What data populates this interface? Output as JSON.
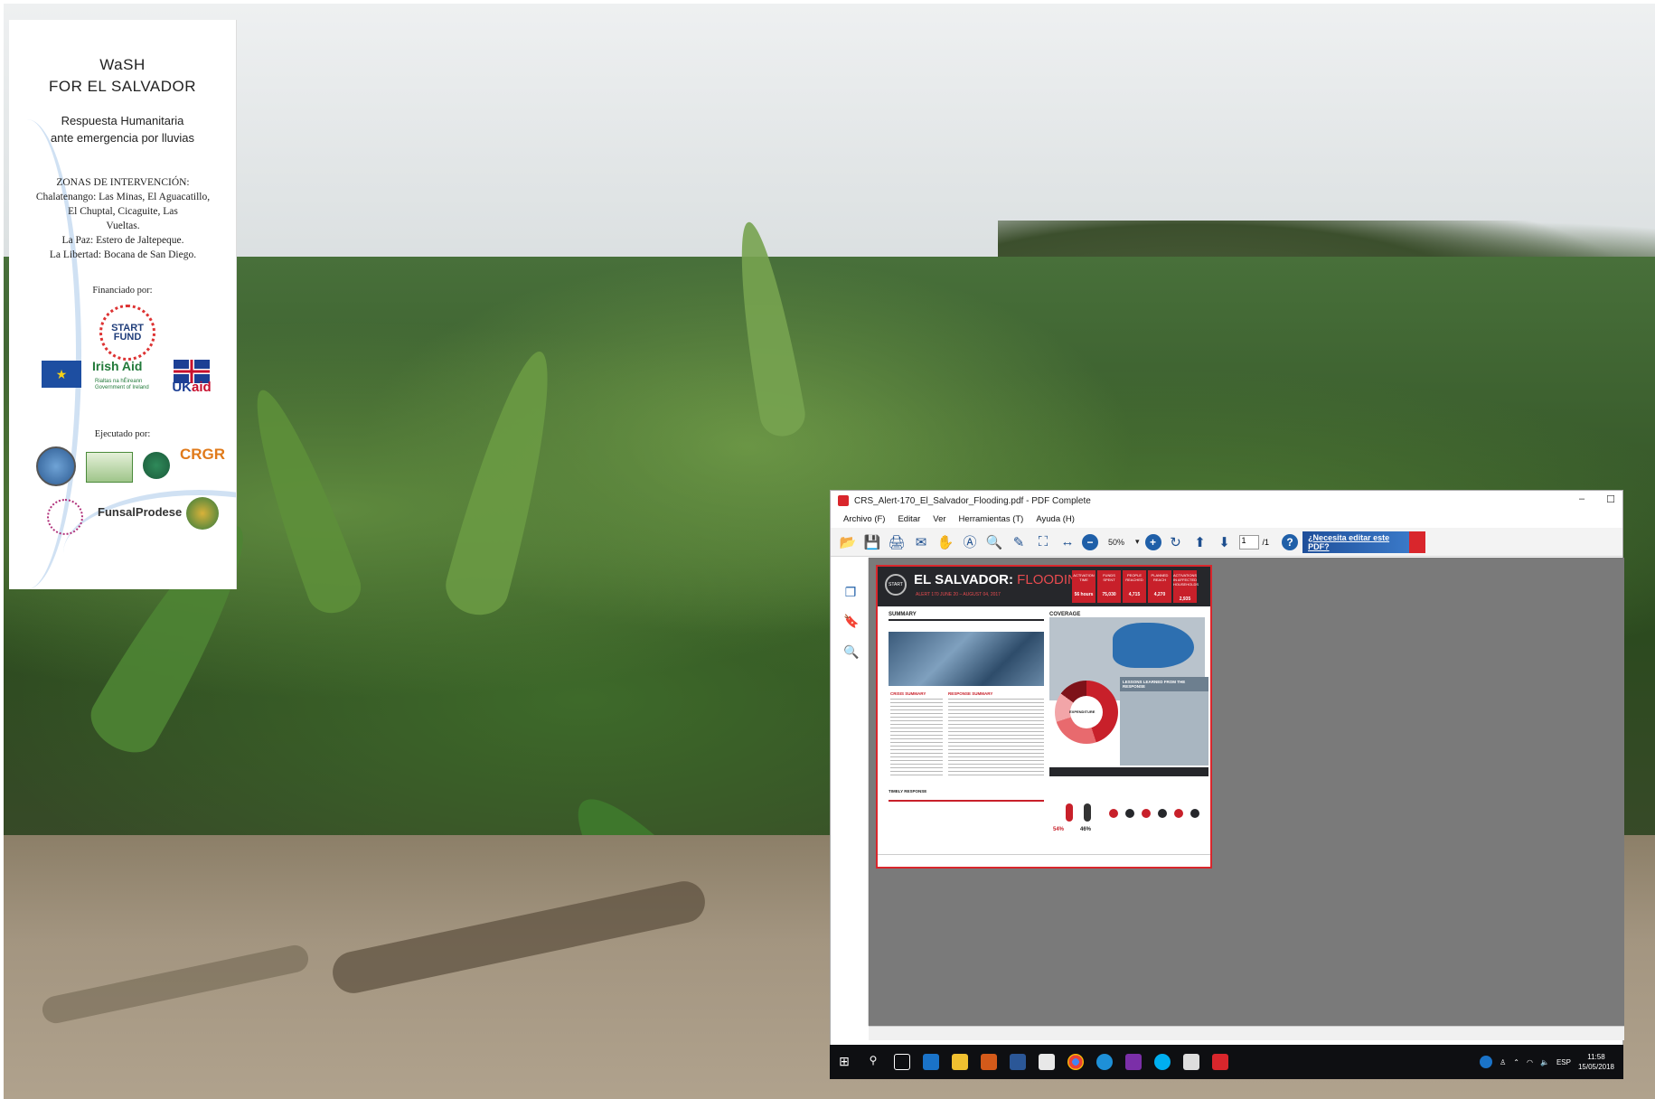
{
  "card": {
    "title_line1": "WaSH",
    "title_line2": "FOR EL SALVADOR",
    "subtitle_line1": "Respuesta Humanitaria",
    "subtitle_line2": "ante emergencia por lluvias",
    "zones_heading": "ZONAS DE INTERVENCIÓN:",
    "zones_line1": "Chalatenango: Las Minas, El Aguacatillo,",
    "zones_line2": "El Chuptal, Cicaguite, Las",
    "zones_line3": "Vueltas.",
    "zones_line4": "La Paz: Estero de Jaltepeque.",
    "zones_line5": "La Libertad: Bocana de San Diego.",
    "funded_by": "Financiado por:",
    "executed_by": "Ejecutado por:",
    "start_logo_l1": "START",
    "start_logo_l2": "FUND",
    "irish_aid": "Irish Aid",
    "irish_aid_sub1": "Rialtas na hÉireann",
    "irish_aid_sub2": "Government of Ireland",
    "uk": "UK",
    "aid": "aid",
    "crgr": "CRGR",
    "funsal": "FunsalProdese"
  },
  "window": {
    "title": "CRS_Alert-170_El_Salvador_Flooding.pdf - PDF Complete",
    "minimize": "–",
    "maximize": "☐",
    "menu": [
      "Archivo (F)",
      "Editar",
      "Ver",
      "Herramientas (T)",
      "Ayuda (H)"
    ],
    "zoom": "50%",
    "page_current": "1",
    "page_total": "/1",
    "ad_text": "¿Necesita editar este PDF?"
  },
  "pdf": {
    "title_a": "EL SALVADOR:",
    "title_b": " FLOODING",
    "date": "ALERT 170 JUNE 20 – AUGUST 04, 2017",
    "stats": [
      {
        "label": "ACTIVATION TIME",
        "value": "56 hours"
      },
      {
        "label": "FUNDS SPENT",
        "value": "75,030"
      },
      {
        "label": "PEOPLE REACHED",
        "value": "4,715"
      },
      {
        "label": "PLANNED REACH",
        "value": "4,270"
      },
      {
        "label": "ACTIVATIONS IN AFFECTED HOUSEHOLDS",
        "value": "2,935"
      }
    ],
    "summary": "SUMMARY",
    "coverage": "COVERAGE",
    "crisis_summary": "CRISIS SUMMARY",
    "response_summary": "RESPONSE SUMMARY",
    "lessons": "LESSONS LEARNED FROM THE RESPONSE",
    "timely": "TIMELY RESPONSE",
    "reach": "REACH",
    "expenditure": "EXPENDITURE",
    "female_pct": "54%",
    "male_pct": "46%"
  },
  "taskbar": {
    "lang": "ESP",
    "time": "11:58",
    "date": "15/05/2018"
  }
}
